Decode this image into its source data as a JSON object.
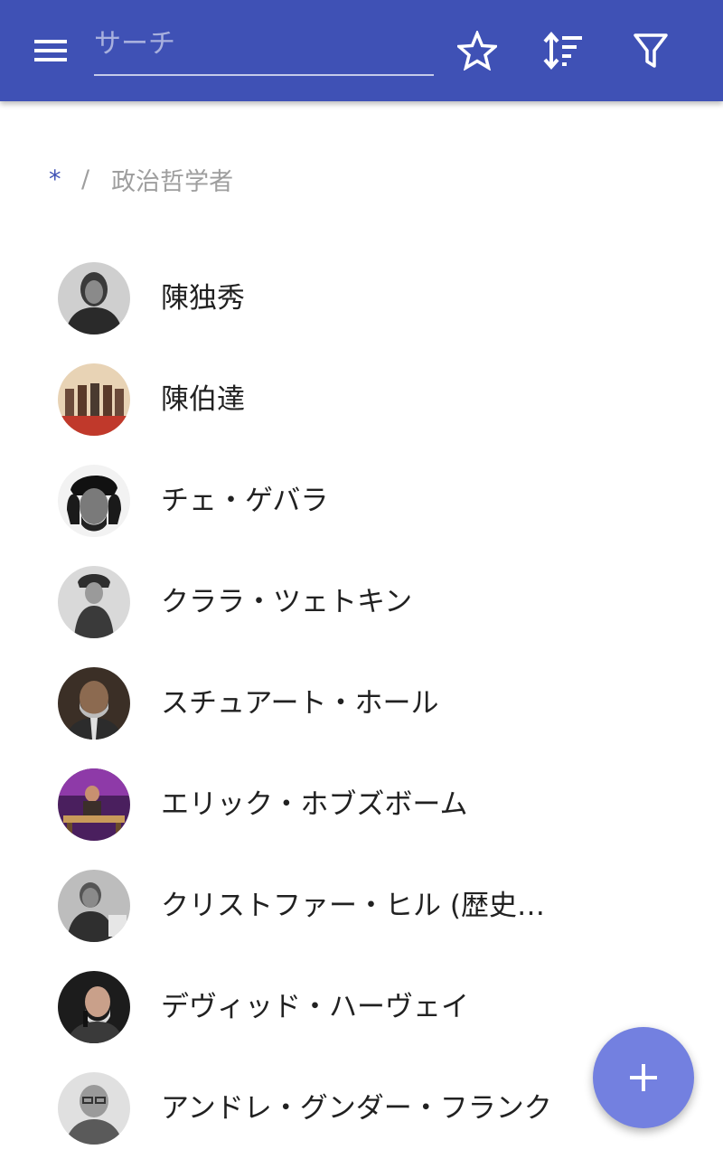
{
  "toolbar": {
    "search_placeholder": "サーチ",
    "search_value": "",
    "menu_icon": "menu-icon",
    "favorite_icon": "star-outline-icon",
    "sort_icon": "sort-icon",
    "filter_icon": "filter-icon"
  },
  "breadcrumb": {
    "root": "*",
    "separator": "/",
    "current": "政治哲学者"
  },
  "items": [
    {
      "label": "陳独秀"
    },
    {
      "label": "陳伯達"
    },
    {
      "label": "チェ・ゲバラ"
    },
    {
      "label": "クララ・ツェトキン"
    },
    {
      "label": "スチュアート・ホール"
    },
    {
      "label": "エリック・ホブズボーム"
    },
    {
      "label": "クリストファー・ヒル (歴史…"
    },
    {
      "label": "デヴィッド・ハーヴェイ"
    },
    {
      "label": "アンドレ・グンダー・フランク"
    }
  ],
  "fab": {
    "icon": "plus-icon"
  },
  "colors": {
    "app_bar": "#3f51b5",
    "fab": "#7380e0",
    "breadcrumb_root": "#3f51b5",
    "secondary_text": "#9e9e9e"
  }
}
